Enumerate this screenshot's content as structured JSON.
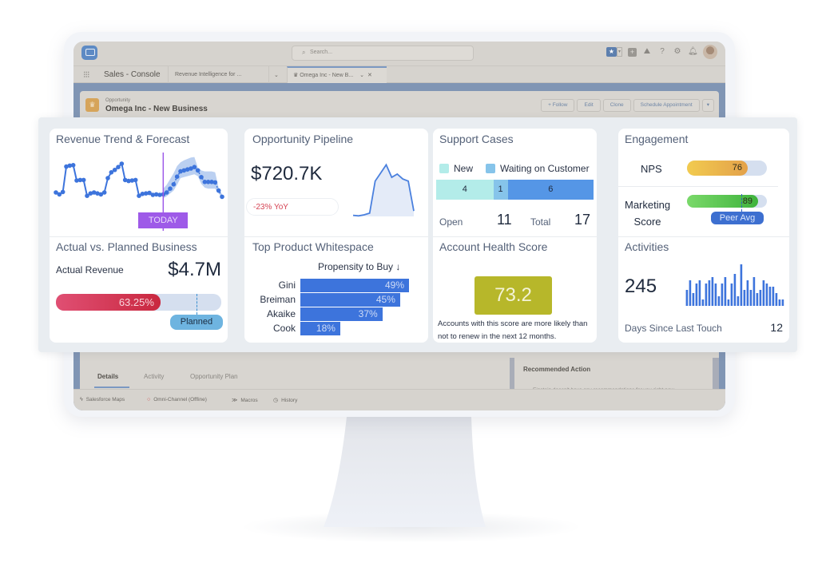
{
  "console": {
    "search_placeholder": "Search...",
    "app_name": "Sales - Console",
    "tabs": [
      {
        "label": "Revenue Intelligence for ...",
        "active": false
      },
      {
        "label": "Omega Inc - New B...",
        "active": true
      }
    ],
    "record": {
      "type": "Opportunity",
      "name": "Omega Inc - New Business"
    },
    "actions": [
      "+ Follow",
      "Edit",
      "Clone",
      "Schedule Appointment",
      "▾"
    ],
    "subtabs": [
      "Details",
      "Activity",
      "Opportunity Plan"
    ],
    "recommended_action": {
      "title": "Recommended Action",
      "text": "Einstein doesn't have any recommendations for you right now."
    },
    "utility_bar": [
      {
        "icon": "lightning-icon",
        "glyph": "ϟ",
        "label": "Salesforce Maps"
      },
      {
        "icon": "offline-circle-icon",
        "glyph": "○",
        "label": "Omni-Channel (Offline)"
      },
      {
        "icon": "macros-icon",
        "glyph": "≫",
        "label": "Macros"
      },
      {
        "icon": "history-clock-icon",
        "glyph": "◷",
        "label": "History"
      }
    ]
  },
  "widgets": {
    "revenue_trend": {
      "title": "Revenue Trend & Forecast",
      "today_label": "TODAY"
    },
    "actual_vs_planned": {
      "title": "Actual vs. Planned Business",
      "label": "Actual Revenue",
      "value": "$4.7M",
      "progress_percent": 63.25,
      "progress_label": "63.25%",
      "planned_percent": 85,
      "planned_label": "Planned"
    },
    "pipeline": {
      "title": "Opportunity Pipeline",
      "value": "$720.7K",
      "yoy": "-23% YoY"
    },
    "whitespace": {
      "title": "Top Product Whitespace",
      "header": "Propensity to Buy ↓",
      "products": [
        {
          "name": "Gini",
          "value": 49,
          "label": "49%"
        },
        {
          "name": "Breiman",
          "value": 45,
          "label": "45%"
        },
        {
          "name": "Akaike",
          "value": 37,
          "label": "37%"
        },
        {
          "name": "Cook",
          "value": 18,
          "label": "18%"
        }
      ]
    },
    "support_cases": {
      "title": "Support Cases",
      "legend": [
        {
          "label": "New",
          "color": "#b3ece9"
        },
        {
          "label": "Waiting on Customer",
          "color": "#86c4ea"
        }
      ],
      "segments": [
        {
          "label": "4",
          "value": 4,
          "color": "#b3ece9"
        },
        {
          "label": "1",
          "value": 1,
          "color": "#86c4ea"
        },
        {
          "label": "6",
          "value": 6,
          "color": "#5596e6"
        }
      ],
      "open_label": "Open",
      "open_value": "11",
      "total_label": "Total",
      "total_value": "17"
    },
    "account_health": {
      "title": "Account Health Score",
      "score": "73.2",
      "description": "Accounts with this score are more likely than not to renew in the next 12 months."
    },
    "engagement": {
      "title": "Engagement",
      "nps_label": "NPS",
      "nps_value": "76",
      "nps_fill_percent": 76,
      "marketing_label_1": "Marketing",
      "marketing_label_2": "Score",
      "marketing_value": "89",
      "marketing_fill_percent": 89,
      "peer_avg_percent": 68,
      "peer_avg_label": "Peer Avg"
    },
    "activities": {
      "title": "Activities",
      "value": "245",
      "days_label": "Days Since Last Touch",
      "days_value": "12"
    }
  },
  "chart_data": [
    {
      "type": "line",
      "title": "Revenue Trend & Forecast",
      "annotation": "TODAY",
      "today_index": 31,
      "series": [
        {
          "name": "actual",
          "values": [
            3,
            2.6,
            3.1,
            8.4,
            8.6,
            8.7,
            5.5,
            5.6,
            5.6,
            2.3,
            2.8,
            3.0,
            2.8,
            2.6,
            3.0,
            6.0,
            7.2,
            7.7,
            8.3,
            9.0,
            5.6,
            5.4,
            5.5,
            5.6,
            2.3,
            2.7,
            2.8,
            2.9,
            2.5,
            2.6,
            2.5,
            2.6
          ]
        },
        {
          "name": "forecast",
          "values": [
            2.6,
            3.0,
            3.8,
            4.7,
            6.3,
            7.4,
            7.6,
            7.8,
            8.0,
            8.3,
            7.6,
            6.2,
            5.2,
            5.2,
            5.2,
            5.1,
            3.4,
            2.1
          ]
        },
        {
          "name": "forecast_upper",
          "values": [
            3.8,
            4.6,
            5.8,
            7.0,
            8.5,
            9.3,
            9.7,
            10.0,
            10.3,
            10.4,
            8.2,
            7.6,
            7.4,
            7.4,
            7.4,
            7.2,
            4.0,
            2.6
          ]
        },
        {
          "name": "forecast_lower",
          "values": [
            1.8,
            2.2,
            2.8,
            3.4,
            4.6,
            6.0,
            6.2,
            6.4,
            6.6,
            6.8,
            6.4,
            4.8,
            4.0,
            3.8,
            3.8,
            3.8,
            2.8,
            1.9
          ]
        }
      ],
      "ylim": [
        0,
        11
      ]
    },
    {
      "type": "area",
      "title": "Opportunity Pipeline",
      "values": [
        0.2,
        0.1,
        0.3,
        0.6,
        6.5,
        8.0,
        9.5,
        7.2,
        7.8,
        6.9,
        6.5,
        1.0
      ],
      "ylim": [
        0,
        10
      ]
    },
    {
      "type": "bar",
      "title": "Activities",
      "values": [
        5,
        8,
        4,
        7,
        8,
        2,
        7,
        8,
        9,
        7,
        3,
        7,
        9,
        2,
        7,
        10,
        3,
        13,
        5,
        8,
        5,
        9,
        4,
        5,
        8,
        7,
        6,
        6,
        4,
        2,
        2
      ],
      "ylim": [
        0,
        14
      ]
    }
  ]
}
